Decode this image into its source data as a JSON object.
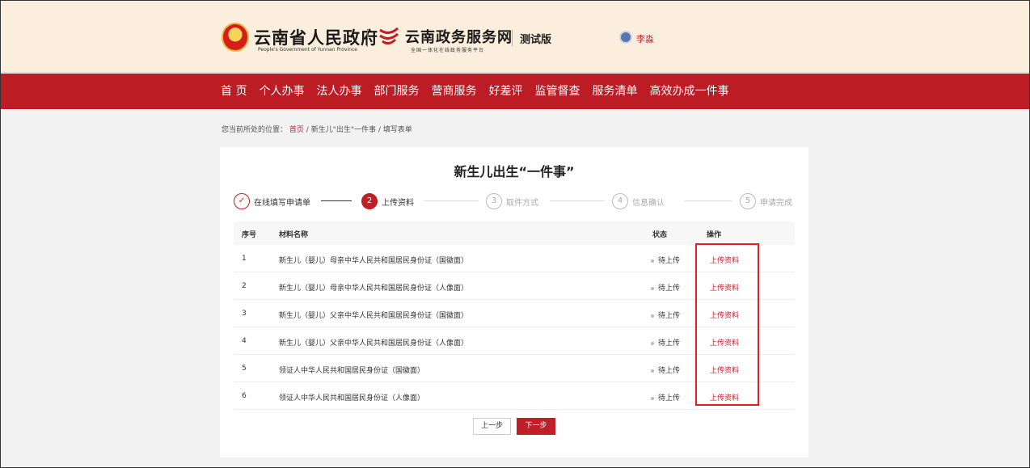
{
  "header": {
    "gov_name": "云南省人民政府",
    "gov_sub": "People's Government of Yunnan Province",
    "service_name": "云南政务服务网",
    "service_sub": "全国一体化在线政务服务平台",
    "test_label": "测试版",
    "user_name": "李淼"
  },
  "nav": {
    "items": [
      "首 页",
      "个人办事",
      "法人办事",
      "部门服务",
      "营商服务",
      "好差评",
      "监管督查",
      "服务清单",
      "高效办成一件事"
    ]
  },
  "breadcrumb": {
    "prefix": "您当前所处的位置：",
    "home": "首页",
    "sep": "/",
    "level1": "新生儿\"出生\"一件事",
    "level2": "填写表单"
  },
  "card": {
    "title": "新生儿出生“一件事”"
  },
  "steps": [
    {
      "num": "✓",
      "label": "在线填写申请单",
      "state": "done"
    },
    {
      "num": "2",
      "label": "上传资料",
      "state": "active"
    },
    {
      "num": "3",
      "label": "取件方式",
      "state": "todo"
    },
    {
      "num": "4",
      "label": "信息确认",
      "state": "todo"
    },
    {
      "num": "5",
      "label": "申请完成",
      "state": "todo"
    }
  ],
  "table": {
    "headers": {
      "index": "序号",
      "name": "材料名称",
      "status": "状态",
      "op": "操作"
    },
    "rows": [
      {
        "index": "1",
        "name": "新生儿（婴儿）母亲中华人民共和国居民身份证（国徽面）",
        "status": "待上传",
        "op": "上传资料"
      },
      {
        "index": "2",
        "name": "新生儿（婴儿）母亲中华人民共和国居民身份证（人像面）",
        "status": "待上传",
        "op": "上传资料"
      },
      {
        "index": "3",
        "name": "新生儿（婴儿）父亲中华人民共和国居民身份证（国徽面）",
        "status": "待上传",
        "op": "上传资料"
      },
      {
        "index": "4",
        "name": "新生儿（婴儿）父亲中华人民共和国居民身份证（人像面）",
        "status": "待上传",
        "op": "上传资料"
      },
      {
        "index": "5",
        "name": "领证人中华人民共和国居民身份证（国徽面）",
        "status": "待上传",
        "op": "上传资料"
      },
      {
        "index": "6",
        "name": "领证人中华人民共和国居民身份证（人像面）",
        "status": "待上传",
        "op": "上传资料"
      }
    ]
  },
  "buttons": {
    "prev": "上一步",
    "next": "下一步"
  },
  "colors": {
    "brand_red": "#bc1c24",
    "header_bg": "#fbeedd"
  }
}
